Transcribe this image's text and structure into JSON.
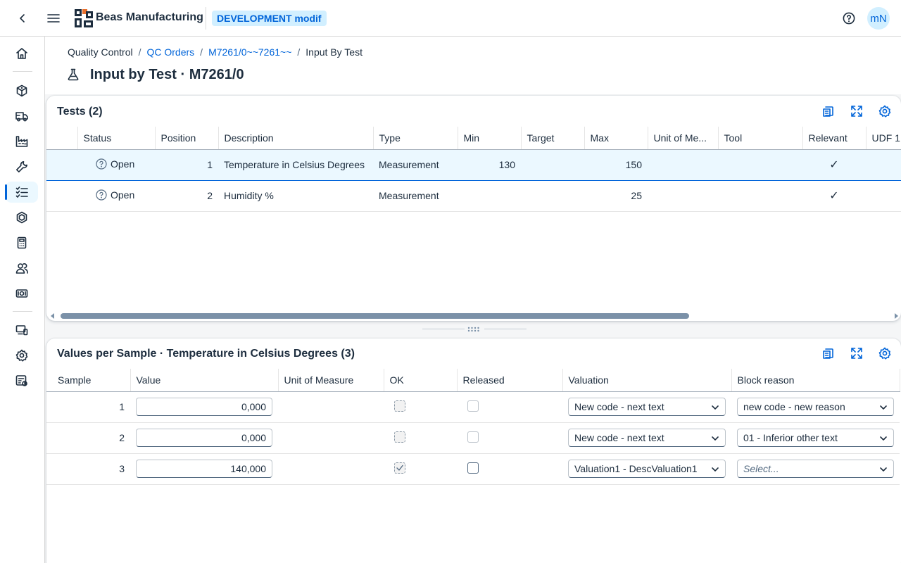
{
  "shell": {
    "company": "Beas Manufacturing",
    "system_badge": "DEVELOPMENT modif",
    "avatar_initials": "mN",
    "brand_color": "#0064d9"
  },
  "sidebar": {
    "items": [
      {
        "icon": "home-icon"
      },
      {
        "icon": "cubes-icon"
      },
      {
        "icon": "truck-icon"
      },
      {
        "icon": "factory-icon"
      },
      {
        "icon": "wrench-icon"
      },
      {
        "icon": "checklist-icon",
        "active": true
      },
      {
        "icon": "hexagon-icon"
      },
      {
        "icon": "calculator-icon"
      },
      {
        "icon": "group-icon"
      },
      {
        "icon": "money-icon"
      },
      {
        "icon": "devices-icon"
      },
      {
        "icon": "settings-icon"
      },
      {
        "icon": "report-icon"
      }
    ]
  },
  "breadcrumb": {
    "items": [
      "Quality Control",
      "QC Orders",
      "M7261/0~~7261~~",
      "Input By Test"
    ],
    "separator": "/"
  },
  "page": {
    "title": "Input by Test · M7261/0"
  },
  "tests": {
    "title": "Tests (2)",
    "columns": [
      "Status",
      "Position",
      "Description",
      "Type",
      "Min",
      "Target",
      "Max",
      "Unit of Me...",
      "Tool",
      "Relevant",
      "UDF 1"
    ],
    "rows": [
      {
        "status": "Open",
        "position": "1",
        "description": "Temperature in Celsius Degrees",
        "type": "Measurement",
        "min": "130",
        "target": "",
        "max": "150",
        "unit": "",
        "tool": "",
        "relevant": "✓",
        "selected": true
      },
      {
        "status": "Open",
        "position": "2",
        "description": "Humidity %",
        "type": "Measurement",
        "min": "",
        "target": "",
        "max": "25",
        "unit": "",
        "tool": "",
        "relevant": "✓",
        "selected": false
      }
    ],
    "scroll_fraction": 0.74
  },
  "values": {
    "title": "Values per Sample · Temperature in Celsius Degrees (3)",
    "columns": [
      "Sample",
      "Value",
      "Unit of Measure",
      "OK",
      "Released",
      "Valuation",
      "Block reason"
    ],
    "rows": [
      {
        "sample": "1",
        "value": "0,000",
        "unit": "",
        "ok": false,
        "ok_enabled": false,
        "released": false,
        "released_enabled": false,
        "valuation": "New code - next text",
        "block_reason": "new code - new reason",
        "block_placeholder": false
      },
      {
        "sample": "2",
        "value": "0,000",
        "unit": "",
        "ok": false,
        "ok_enabled": false,
        "released": false,
        "released_enabled": false,
        "valuation": "New code - next text",
        "block_reason": "01 - Inferior other text",
        "block_placeholder": false
      },
      {
        "sample": "3",
        "value": "140,000",
        "unit": "",
        "ok": true,
        "ok_enabled": false,
        "released": false,
        "released_enabled": true,
        "valuation": "Valuation1 - DescValuation1",
        "block_reason": "Select...",
        "block_placeholder": true
      }
    ]
  }
}
